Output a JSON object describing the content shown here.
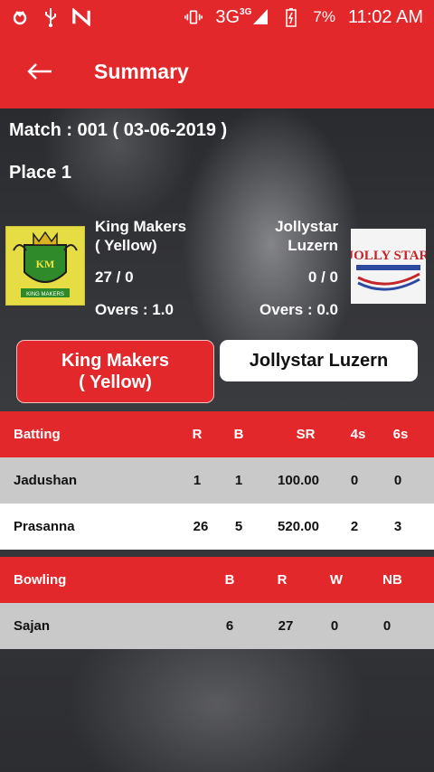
{
  "status_bar": {
    "network": "3G",
    "network_sup": "3G",
    "battery_percent": "7%",
    "time": "11:02 AM",
    "left_icons": [
      "app-notification-icon",
      "usb-icon",
      "n-icon"
    ],
    "right_icons": [
      "vibrate-icon",
      "signal-icon",
      "battery-charging-icon"
    ]
  },
  "appbar": {
    "title": "Summary"
  },
  "match": {
    "line": "Match : 001 ( 03-06-2019 )",
    "place": "Place 1"
  },
  "team_left": {
    "name_line1": "King Makers",
    "name_line2": "( Yellow)",
    "score": "27 / 0",
    "overs": "Overs : 1.0",
    "logo_text": "KING MAKERS"
  },
  "team_right": {
    "name_line1": "Jollystar",
    "name_line2": "Luzern",
    "score": "0 / 0",
    "overs": "Overs : 0.0",
    "logo_text": "JOLLY STAR"
  },
  "tabs": [
    {
      "line1": "King Makers",
      "line2": "( Yellow)",
      "active": true
    },
    {
      "line1": "Jollystar Luzern",
      "active": false
    }
  ],
  "batting": {
    "headers": [
      "Batting",
      "R",
      "B",
      "SR",
      "4s",
      "6s"
    ],
    "rows": [
      [
        "Jadushan",
        "1",
        "1",
        "100.00",
        "0",
        "0"
      ],
      [
        "Prasanna",
        "26",
        "5",
        "520.00",
        "2",
        "3"
      ]
    ]
  },
  "bowling": {
    "headers": [
      "Bowling",
      "B",
      "R",
      "W",
      "NB"
    ],
    "rows": [
      [
        "Sajan",
        "6",
        "27",
        "0",
        "0"
      ]
    ]
  },
  "colors": {
    "accent": "#e3282b",
    "row_grey": "#c9c9c9"
  }
}
